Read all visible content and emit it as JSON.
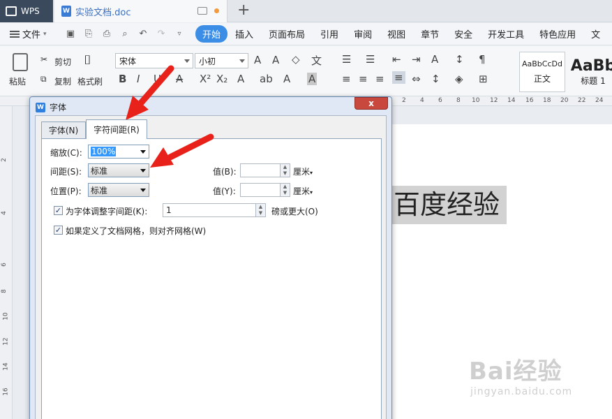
{
  "titlebar": {
    "app_label": "WPS",
    "doc_tab_label": "实验文档.doc",
    "new_tab": "+"
  },
  "menubar": {
    "file_label": "文件",
    "items": [
      "开始",
      "插入",
      "页面布局",
      "引用",
      "审阅",
      "视图",
      "章节",
      "安全",
      "开发工具",
      "特色应用",
      "文"
    ]
  },
  "ribbon": {
    "paste": "粘贴",
    "cut": "剪切",
    "copy": "复制",
    "format_painter": "格式刷",
    "font_name": "宋体",
    "font_size": "小初",
    "style_normal_preview": "AaBbCcDd",
    "style_normal_label": "正文",
    "style_heading_preview": "AaBb",
    "style_heading_label": "标题 1"
  },
  "ruler": {
    "top_numbers": [
      "2",
      "4",
      "6",
      "8",
      "10",
      "12",
      "14",
      "16",
      "18",
      "20",
      "22",
      "24"
    ],
    "left_numbers": [
      "2",
      "4",
      "6",
      "8",
      "10",
      "12",
      "14",
      "16"
    ]
  },
  "document": {
    "text": "百度经验"
  },
  "dialog": {
    "title": "字体",
    "close": "x",
    "tabs": [
      {
        "label": "字体(N)",
        "active": false
      },
      {
        "label": "字符间距(R)",
        "active": true
      }
    ],
    "scale_label": "缩放(C):",
    "scale_value": "100%",
    "spacing_label": "间距(S):",
    "spacing_value": "标准",
    "position_label": "位置(P):",
    "position_value": "标准",
    "value_b_label": "值(B):",
    "value_y_label": "值(Y):",
    "unit_label": "厘米",
    "kerning_label": "为字体调整字间距(K):",
    "kerning_value": "1",
    "kerning_suffix": "磅或更大(O)",
    "kerning_checked": true,
    "grid_label": "如果定义了文档网格，则对齐网格(W)",
    "grid_checked": true
  },
  "watermark": {
    "brand": "Bai经验",
    "url": "jingyan.baidu.com"
  },
  "colors": {
    "accent": "#3b8de6",
    "annotation_arrow": "#e8221b",
    "close_button": "#c9483d"
  }
}
